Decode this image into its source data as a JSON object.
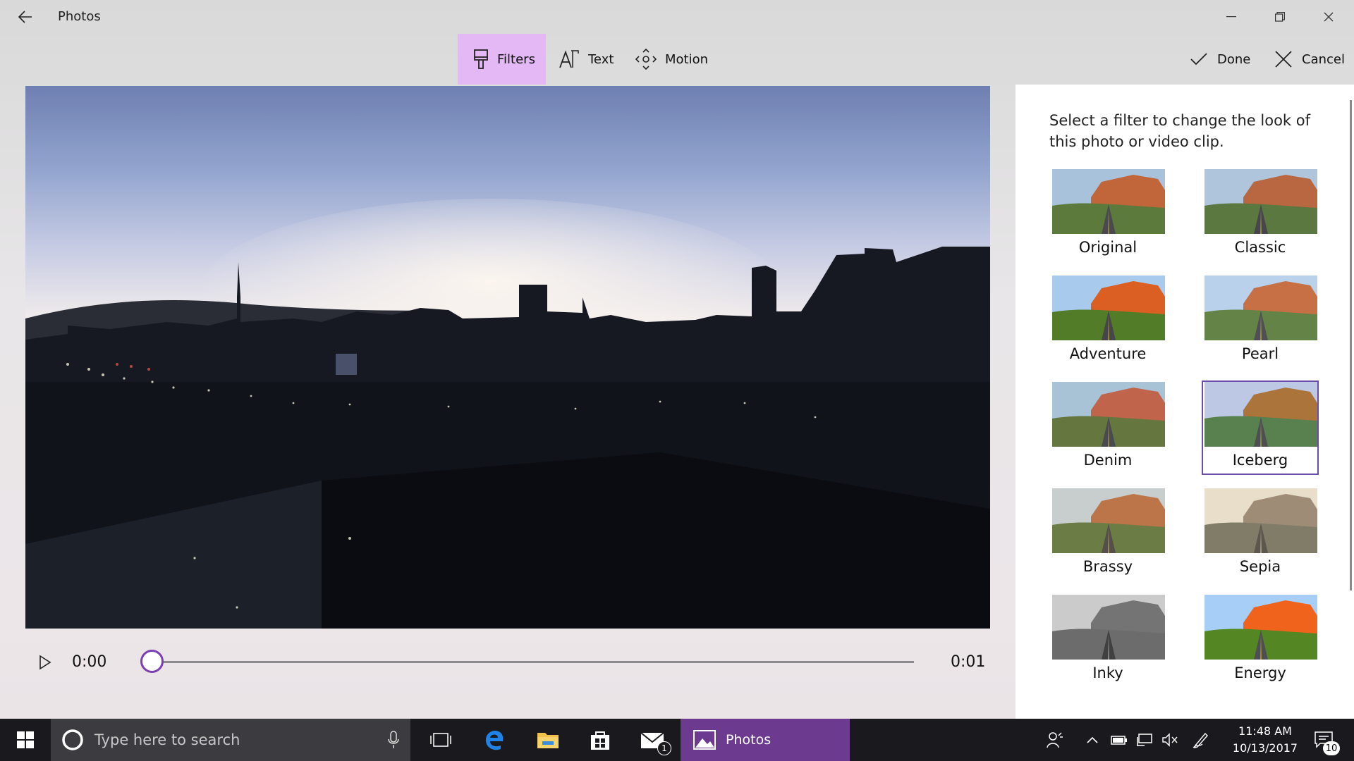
{
  "window": {
    "title": "Photos",
    "back_icon": "back-arrow-icon",
    "controls": [
      "minimize-icon",
      "restore-icon",
      "close-icon"
    ]
  },
  "toolbar": {
    "tools": [
      {
        "label": "Filters",
        "icon": "filters-brush-icon",
        "active": true
      },
      {
        "label": "Text",
        "icon": "text-icon",
        "active": false
      },
      {
        "label": "Motion",
        "icon": "motion-icon",
        "active": false
      }
    ],
    "done_label": "Done",
    "cancel_label": "Cancel"
  },
  "playback": {
    "current_time": "0:00",
    "duration": "0:01",
    "progress": 0
  },
  "filter_panel": {
    "description": "Select a filter to change the look of this photo or video clip.",
    "selected": "Iceberg",
    "filters": [
      "Original",
      "Classic",
      "Adventure",
      "Pearl",
      "Denim",
      "Iceberg",
      "Brassy",
      "Sepia",
      "Inky",
      "Energy"
    ]
  },
  "taskbar": {
    "search_placeholder": "Type here to search",
    "mail_badge": "1",
    "active_app": "Photos",
    "time": "11:48 AM",
    "date": "10/13/2017",
    "notification_count": "10"
  },
  "colors": {
    "accent": "#7b3fb3",
    "tool_active_bg": "#e3b8f5",
    "taskbar_bg": "#1a1a1e",
    "photos_task_bg": "#6c3b8f"
  }
}
